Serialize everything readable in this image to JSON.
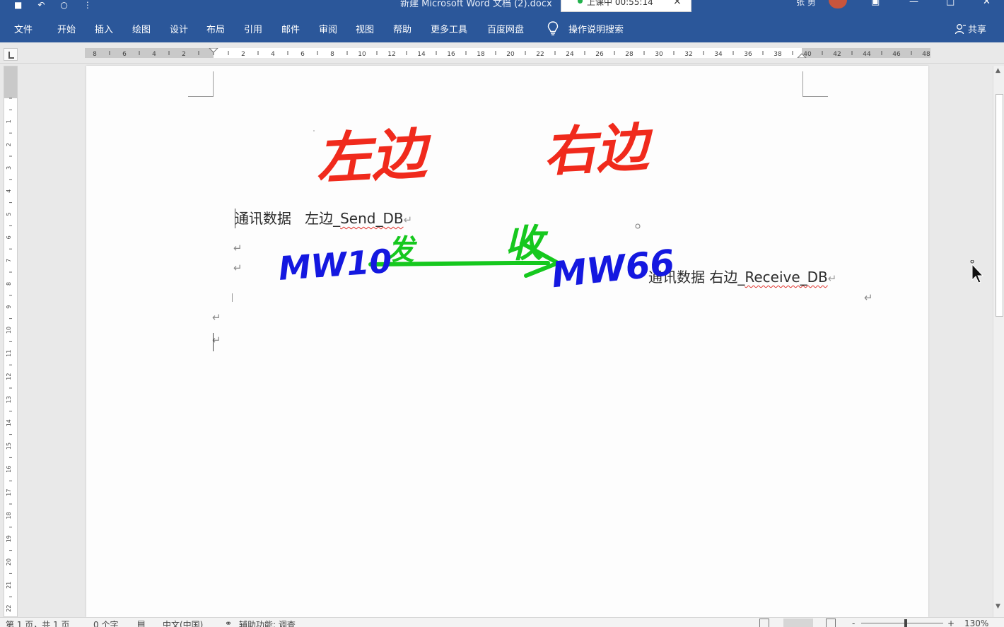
{
  "window": {
    "doc_title": "新建 Microsoft Word 文档 (2).docx",
    "recording_status": "上课中 00:55:14",
    "recording_close": "×",
    "user_name": "张 勇"
  },
  "ribbon": {
    "tabs": [
      {
        "id": "file",
        "label": "文件"
      },
      {
        "id": "home",
        "label": "开始"
      },
      {
        "id": "insert",
        "label": "插入"
      },
      {
        "id": "draw",
        "label": "绘图"
      },
      {
        "id": "design",
        "label": "设计"
      },
      {
        "id": "layout",
        "label": "布局"
      },
      {
        "id": "references",
        "label": "引用"
      },
      {
        "id": "mailings",
        "label": "邮件"
      },
      {
        "id": "review",
        "label": "审阅"
      },
      {
        "id": "view",
        "label": "视图"
      },
      {
        "id": "help",
        "label": "帮助"
      },
      {
        "id": "more-tools",
        "label": "更多工具"
      },
      {
        "id": "baidu-disk",
        "label": "百度网盘"
      }
    ],
    "tell_me": "操作说明搜索",
    "share": "共享"
  },
  "document": {
    "left_line": {
      "label": "通讯数据",
      "side": "左边",
      "db": "Send_DB"
    },
    "right_line": {
      "label": "通讯数据",
      "side": "右边",
      "db": "Receive_DB"
    },
    "handwriting": {
      "left_title": "左边",
      "right_title": "右边",
      "send": "发",
      "receive": "收",
      "source_address": "MW10",
      "target_address": "MW66",
      "colors": {
        "title": "#f02a1c",
        "address": "#1418e0",
        "arrow": "#16c81e"
      }
    },
    "paragraph_mark": "↵"
  },
  "statusbar": {
    "page": "第 1 页，共 1 页",
    "words": "0 个字",
    "language": "中文(中国)",
    "accessibility": "辅助功能: 调查",
    "zoom_minus": "-",
    "zoom_plus": "+",
    "zoom_level": "130%"
  }
}
